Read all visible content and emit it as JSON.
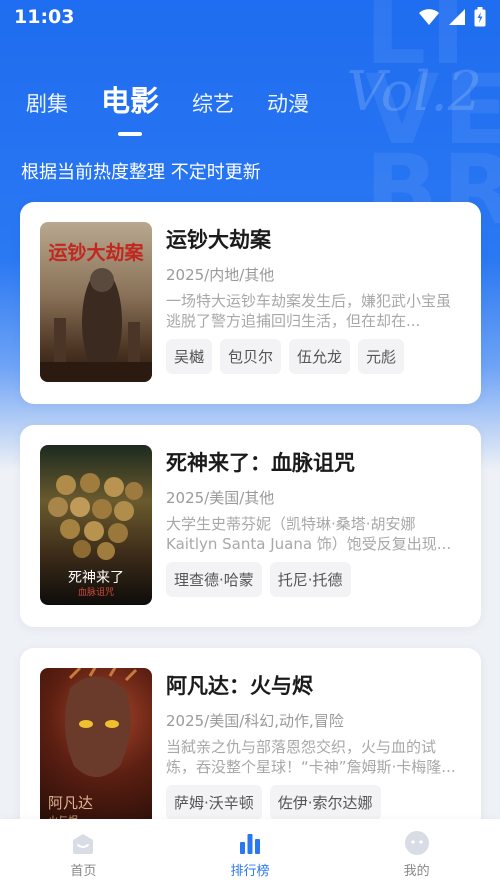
{
  "status": {
    "time": "11:03"
  },
  "tabs": [
    {
      "label": "剧集"
    },
    {
      "label": "电影"
    },
    {
      "label": "综艺"
    },
    {
      "label": "动漫"
    }
  ],
  "active_tab": "电影",
  "subtitle": "根据当前热度整理 不定时更新",
  "movies": [
    {
      "title": "运钞大劫案",
      "meta": "2025/内地/其他",
      "desc": "一场特大运钞车劫案发生后，嫌犯武小宝虽逃脱了警方追捕回归生活，但在却在...",
      "actors": [
        "吴樾",
        "包贝尔",
        "伍允龙",
        "元彪"
      ],
      "poster_title": "运钞大劫案"
    },
    {
      "title": "死神来了：血脉诅咒",
      "meta": "2025/美国/其他",
      "desc": "大学生史蒂芬妮（凯特琳·桑塔·胡安娜 Kaitlyn Santa Juana 饰）饱受反复出现...",
      "actors": [
        "理查德·哈蒙",
        "托尼·托德"
      ],
      "poster_title": "死神来了",
      "poster_subtitle": "血脉诅咒"
    },
    {
      "title": "阿凡达：火与烬",
      "meta": "2025/美国/科幻,动作,冒险",
      "desc": "当弑亲之仇与部落恩怨交织，火与血的试炼，吞没整个星球！“卡神”詹姆斯·卡梅隆...",
      "actors": [
        "萨姆·沃辛顿",
        "佐伊·索尔达娜"
      ],
      "poster_title": "阿凡达",
      "poster_subtitle": "火与烬"
    }
  ],
  "nav": [
    {
      "label": "首页",
      "icon": "home-icon"
    },
    {
      "label": "排行榜",
      "icon": "ranking-icon"
    },
    {
      "label": "我的",
      "icon": "profile-icon"
    }
  ],
  "colors": {
    "primary": "#2a77f2",
    "background": "#eef1f6"
  }
}
